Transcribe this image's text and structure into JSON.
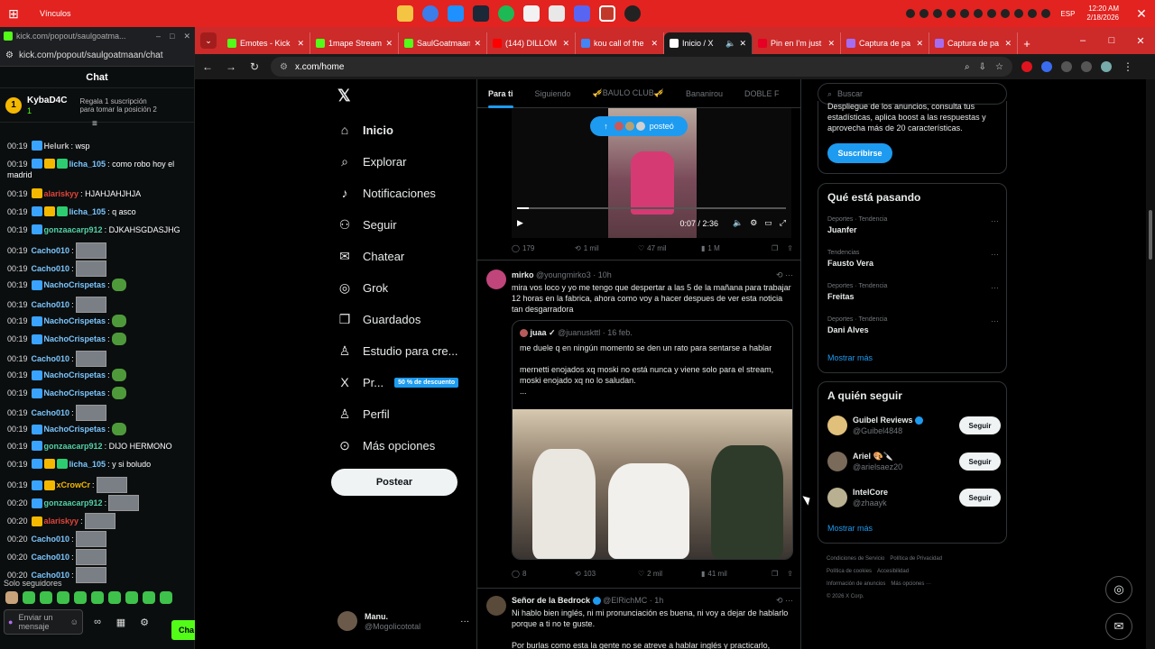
{
  "taskbar": {
    "title": "Vínculos",
    "lang": "ESP",
    "time": "12:20 AM",
    "date": "2/18/2026",
    "pinned_icons": [
      "file-explorer-icon",
      "chrome-icon",
      "edge-icon",
      "steam-icon",
      "spotify-icon",
      "store-icon",
      "chat-icon",
      "discord-icon",
      "chrome-red-icon",
      "obs-icon"
    ]
  },
  "kick": {
    "tab_title": "kick.com/popout/saulgoatma...",
    "url": "kick.com/popout/saulgoatmaan/chat",
    "header": "Chat",
    "pinned": {
      "rank": "1",
      "user": "KybaD4C",
      "count": "1",
      "text": "Regala 1 suscripción para tomar la posición 2"
    },
    "messages": [
      {
        "time": "00:19",
        "user": "Helurk",
        "color": "#bfbfbf",
        "text": ": wsp",
        "badges": [
          "blue"
        ],
        "emote": ""
      },
      {
        "time": "00:19",
        "user": "licha_105",
        "color": "#7cc7ff",
        "text": ": como robo hoy el",
        "badges": [
          "blue",
          "gold",
          "green"
        ],
        "emote": "",
        "wrap": "madrid"
      },
      {
        "time": "00:19",
        "user": "alariskyy",
        "color": "#e0443a",
        "text": ": HJAHJAHJHJA",
        "badges": [
          "gold"
        ],
        "emote": ""
      },
      {
        "time": "00:19",
        "user": "licha_105",
        "color": "#7cc7ff",
        "text": ": q asco",
        "badges": [
          "blue",
          "gold",
          "green"
        ],
        "emote": ""
      },
      {
        "time": "00:19",
        "user": "gonzaacarp912",
        "color": "#53d1a6",
        "text": ": DJKAHSGDASJHG",
        "badges": [
          "blue"
        ],
        "emote": ""
      },
      {
        "time": "00:19",
        "user": "Cacho010",
        "color": "#7cc7ff",
        "text": ":",
        "badges": [],
        "emote": "thumb"
      },
      {
        "time": "00:19",
        "user": "Cacho010",
        "color": "#7cc7ff",
        "text": ":",
        "badges": [],
        "emote": "thumb"
      },
      {
        "time": "00:19",
        "user": "NachoCrispetas",
        "color": "#7cc7ff",
        "text": ":",
        "badges": [
          "blue"
        ],
        "emote": "pepe"
      },
      {
        "time": "00:19",
        "user": "Cacho010",
        "color": "#7cc7ff",
        "text": ":",
        "badges": [],
        "emote": "thumb"
      },
      {
        "time": "00:19",
        "user": "NachoCrispetas",
        "color": "#7cc7ff",
        "text": ":",
        "badges": [
          "blue"
        ],
        "emote": "pepe"
      },
      {
        "time": "00:19",
        "user": "NachoCrispetas",
        "color": "#7cc7ff",
        "text": ":",
        "badges": [
          "blue"
        ],
        "emote": "pepe"
      },
      {
        "time": "00:19",
        "user": "Cacho010",
        "color": "#7cc7ff",
        "text": ":",
        "badges": [],
        "emote": "thumb"
      },
      {
        "time": "00:19",
        "user": "NachoCrispetas",
        "color": "#7cc7ff",
        "text": ":",
        "badges": [
          "blue"
        ],
        "emote": "pepe"
      },
      {
        "time": "00:19",
        "user": "NachoCrispetas",
        "color": "#7cc7ff",
        "text": ":",
        "badges": [
          "blue"
        ],
        "emote": "pepe"
      },
      {
        "time": "00:19",
        "user": "Cacho010",
        "color": "#7cc7ff",
        "text": ":",
        "badges": [],
        "emote": "thumb"
      },
      {
        "time": "00:19",
        "user": "NachoCrispetas",
        "color": "#7cc7ff",
        "text": ":",
        "badges": [
          "blue"
        ],
        "emote": "pepe"
      },
      {
        "time": "00:19",
        "user": "gonzaacarp912",
        "color": "#53d1a6",
        "text": ": DIJO HERMONO",
        "badges": [
          "blue"
        ],
        "emote": ""
      },
      {
        "time": "00:19",
        "user": "licha_105",
        "color": "#7cc7ff",
        "text": ": y si boludo",
        "badges": [
          "blue",
          "gold",
          "green"
        ],
        "emote": ""
      },
      {
        "time": "00:19",
        "user": "xCrowCr",
        "color": "#f5b800",
        "text": ":",
        "badges": [
          "blue",
          "gold"
        ],
        "emote": "thumb"
      },
      {
        "time": "00:20",
        "user": "gonzaacarp912",
        "color": "#53d1a6",
        "text": ":",
        "badges": [
          "blue"
        ],
        "emote": "thumb"
      },
      {
        "time": "00:20",
        "user": "alariskyy",
        "color": "#e0443a",
        "text": ":",
        "badges": [
          "gold"
        ],
        "emote": "thumb"
      },
      {
        "time": "00:20",
        "user": "Cacho010",
        "color": "#7cc7ff",
        "text": ":",
        "badges": [],
        "emote": "thumb"
      },
      {
        "time": "00:20",
        "user": "Cacho010",
        "color": "#7cc7ff",
        "text": ":",
        "badges": [],
        "emote": "thumb"
      },
      {
        "time": "00:20",
        "user": "Cacho010",
        "color": "#7cc7ff",
        "text": ":",
        "badges": [],
        "emote": "thumb"
      }
    ],
    "followers_only": "Solo seguidores",
    "input_placeholder": "Enviar un mensaje",
    "chat_button": "Cha"
  },
  "browser": {
    "tabs": [
      {
        "label": "Emotes - Kick",
        "color": "#53fc18"
      },
      {
        "label": "1mape Stream",
        "color": "#53fc18"
      },
      {
        "label": "SaulGoatmaan",
        "color": "#53fc18"
      },
      {
        "label": "(144) DILLOM",
        "color": "#ff0000"
      },
      {
        "label": "kou call of the",
        "color": "#4285f4"
      },
      {
        "label": "Inicio / X",
        "color": "#ffffff",
        "active": true
      },
      {
        "label": "Pin en I'm just",
        "color": "#e60023"
      },
      {
        "label": "Captura de pa",
        "color": "#a56cf0"
      },
      {
        "label": "Captura de pa",
        "color": "#a56cf0"
      }
    ],
    "url": "x.com/home"
  },
  "x": {
    "nav": [
      {
        "label": "Inicio",
        "icon": "home-icon",
        "glyph": "⌂",
        "active": true
      },
      {
        "label": "Explorar",
        "icon": "search-icon",
        "glyph": "⌕"
      },
      {
        "label": "Notificaciones",
        "icon": "bell-icon",
        "glyph": "♪"
      },
      {
        "label": "Seguir",
        "icon": "follow-icon",
        "glyph": "⚇"
      },
      {
        "label": "Chatear",
        "icon": "mail-icon",
        "glyph": "✉"
      },
      {
        "label": "Grok",
        "icon": "grok-icon",
        "glyph": "◎"
      },
      {
        "label": "Guardados",
        "icon": "bookmark-icon",
        "glyph": "❒"
      },
      {
        "label": "Estudio para cre...",
        "icon": "studio-icon",
        "glyph": "♙"
      },
      {
        "label": "Pr...",
        "icon": "x-logo-icon",
        "glyph": "X"
      },
      {
        "label": "Perfil",
        "icon": "profile-icon",
        "glyph": "♙"
      },
      {
        "label": "Más opciones",
        "icon": "more-icon",
        "glyph": "⊙"
      }
    ],
    "promo_badge": "50 % de descuento",
    "post_button": "Postear",
    "me": {
      "name": "Manu.",
      "handle": "@Mogolicototal"
    },
    "feed_tabs": [
      "Para ti",
      "Siguiendo",
      "🎺BAULO CLUB🎺",
      "Bananirou",
      "DOBLE F"
    ],
    "posted_pill": "posteó",
    "video": {
      "time": "0:07 / 2:36",
      "progress": 0.045
    },
    "post1_actions": {
      "replies": "179",
      "reposts": "1 mil",
      "likes": "47 mil",
      "views": "1 M"
    },
    "post2": {
      "name": "mirko",
      "handle": "@youngmirko3 · 10h",
      "text": "mira vos loco y yo me tengo que despertar a las 5 de la mañana para trabajar 12 horas en la fabrica, ahora como voy a hacer despues de ver esta noticia tan desgarradora",
      "quote": {
        "name": "juaa ✓",
        "handle": "@juanuskttl · 16 feb.",
        "line1": "me duele q en ningún momento se den un rato para sentarse a hablar",
        "line2": "mernetti enojados xq moski no está nunca y viene solo para el stream, moski enojado xq no lo saludan.",
        "line3": "..."
      },
      "actions": {
        "replies": "8",
        "reposts": "103",
        "likes": "2 mil",
        "views": "41 mil"
      }
    },
    "post3": {
      "name": "Señor de la Bedrock",
      "handle": "@ElRichMC · 1h",
      "text1": "Ni hablo bien inglés, ni mi pronunciación es buena, ni voy a dejar de hablarlo porque a ti no te guste.",
      "text2": "Por burlas como esta la gente no se atreve a hablar inglés y practicarlo,"
    },
    "search_placeholder": "Buscar",
    "premium_text": "Despliegue de los anuncios, consulta tus estadísticas, aplica boost a las respuestas y aprovecha más de 20 características.",
    "subscribe": "Suscribirse",
    "trending_title": "Qué está pasando",
    "trends": [
      {
        "meta": "Deportes · Tendencia",
        "name": "Juanfer"
      },
      {
        "meta": "Tendencias",
        "name": "Fausto Vera"
      },
      {
        "meta": "Deportes · Tendencia",
        "name": "Freitas"
      },
      {
        "meta": "Deportes · Tendencia",
        "name": "Dani Alves"
      }
    ],
    "show_more": "Mostrar más",
    "who_title": "A quién seguir",
    "who": [
      {
        "name": "Guibel Reviews",
        "handle": "@Guibel4848",
        "verified": true
      },
      {
        "name": "Ariel 🎨🔪",
        "handle": "@arielsaez20",
        "verified": false
      },
      {
        "name": "IntelCore",
        "handle": "@zhaayk",
        "verified": false
      }
    ],
    "follow_label": "Seguir",
    "footer": [
      "Condiciones de Servicio",
      "Política de Privacidad",
      "Política de cookies",
      "Accesibilidad",
      "Información de anuncios",
      "Más opciones ···",
      "© 2026 X Corp."
    ]
  }
}
